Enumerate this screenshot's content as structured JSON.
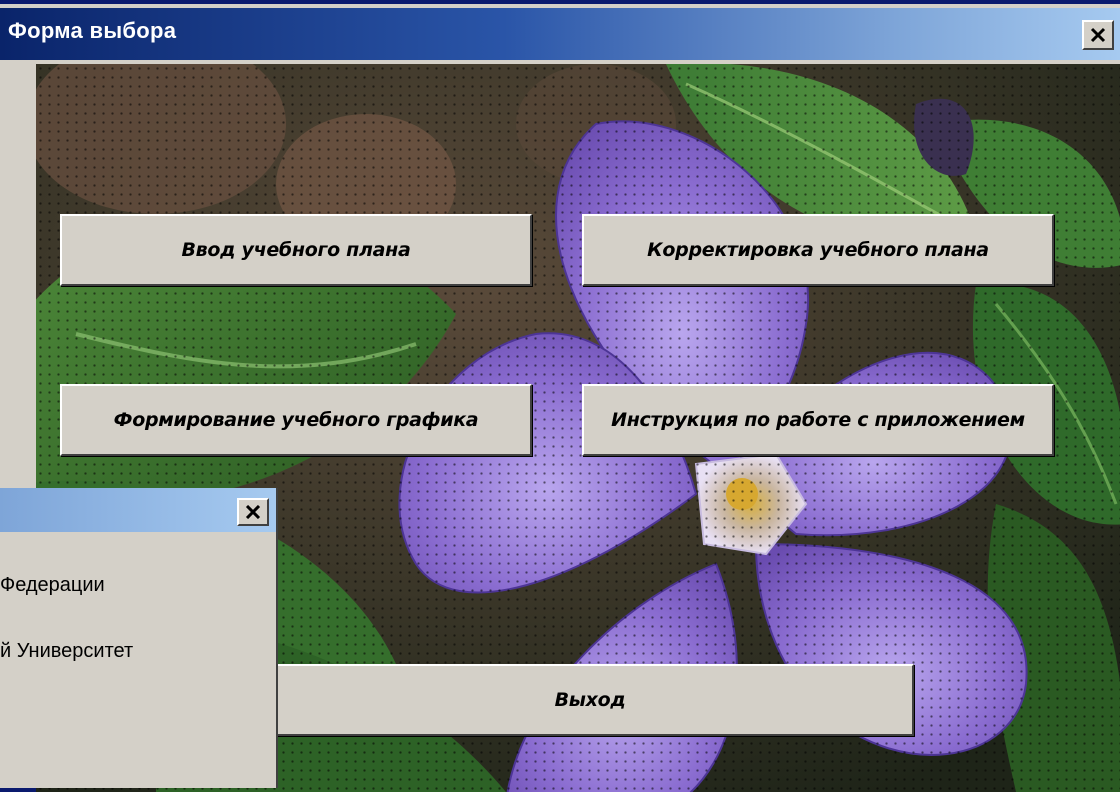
{
  "main_window": {
    "title": "Форма выбора",
    "close_label": "×",
    "buttons": {
      "enter_plan": "Ввод учебного плана",
      "correct_plan": "Корректировка учебного плана",
      "form_schedule": "Формирование учебного графика",
      "instructions": "Инструкция по работе с приложением",
      "exit": "Выход"
    }
  },
  "background_window": {
    "close_label": "×",
    "lines": [
      "Федерации",
      "й Университет"
    ]
  },
  "colors": {
    "titlebar_start": "#0a246a",
    "titlebar_end": "#a6caf0",
    "button_face": "#d4d0c8",
    "flower": "#8a6cd0"
  }
}
